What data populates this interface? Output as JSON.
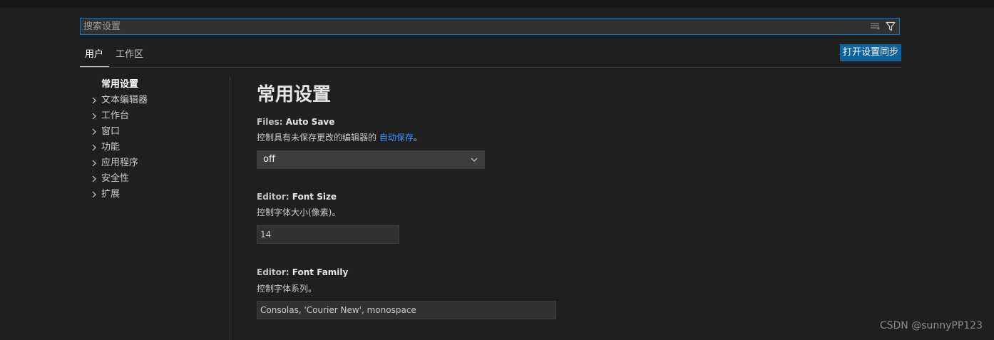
{
  "search": {
    "placeholder": "搜索设置",
    "value": ""
  },
  "tabs": [
    {
      "label": "用户",
      "active": true
    },
    {
      "label": "工作区",
      "active": false
    }
  ],
  "sync_button": {
    "label": "打开设置同步"
  },
  "toc": [
    {
      "label": "常用设置",
      "active": true,
      "expandable": false
    },
    {
      "label": "文本编辑器",
      "active": false,
      "expandable": true
    },
    {
      "label": "工作台",
      "active": false,
      "expandable": true
    },
    {
      "label": "窗口",
      "active": false,
      "expandable": true
    },
    {
      "label": "功能",
      "active": false,
      "expandable": true
    },
    {
      "label": "应用程序",
      "active": false,
      "expandable": true
    },
    {
      "label": "安全性",
      "active": false,
      "expandable": true
    },
    {
      "label": "扩展",
      "active": false,
      "expandable": true
    }
  ],
  "main": {
    "title": "常用设置",
    "settings": [
      {
        "category": "Files: ",
        "name": "Auto Save",
        "desc_before": "控制具有未保存更改的编辑器的 ",
        "desc_link": "自动保存",
        "desc_after": "。",
        "control": "select",
        "value": "off"
      },
      {
        "category": "Editor: ",
        "name": "Font Size",
        "desc": "控制字体大小(像素)。",
        "control": "text",
        "value": "14"
      },
      {
        "category": "Editor: ",
        "name": "Font Family",
        "desc": "控制字体系列。",
        "control": "text",
        "value": "Consolas, 'Courier New', monospace"
      }
    ]
  },
  "watermark": "CSDN @sunnyPP123",
  "colors": {
    "background": "#1f1f1f",
    "focus_border": "#0078d4",
    "button": "#0e639c",
    "link": "#3794ff"
  }
}
